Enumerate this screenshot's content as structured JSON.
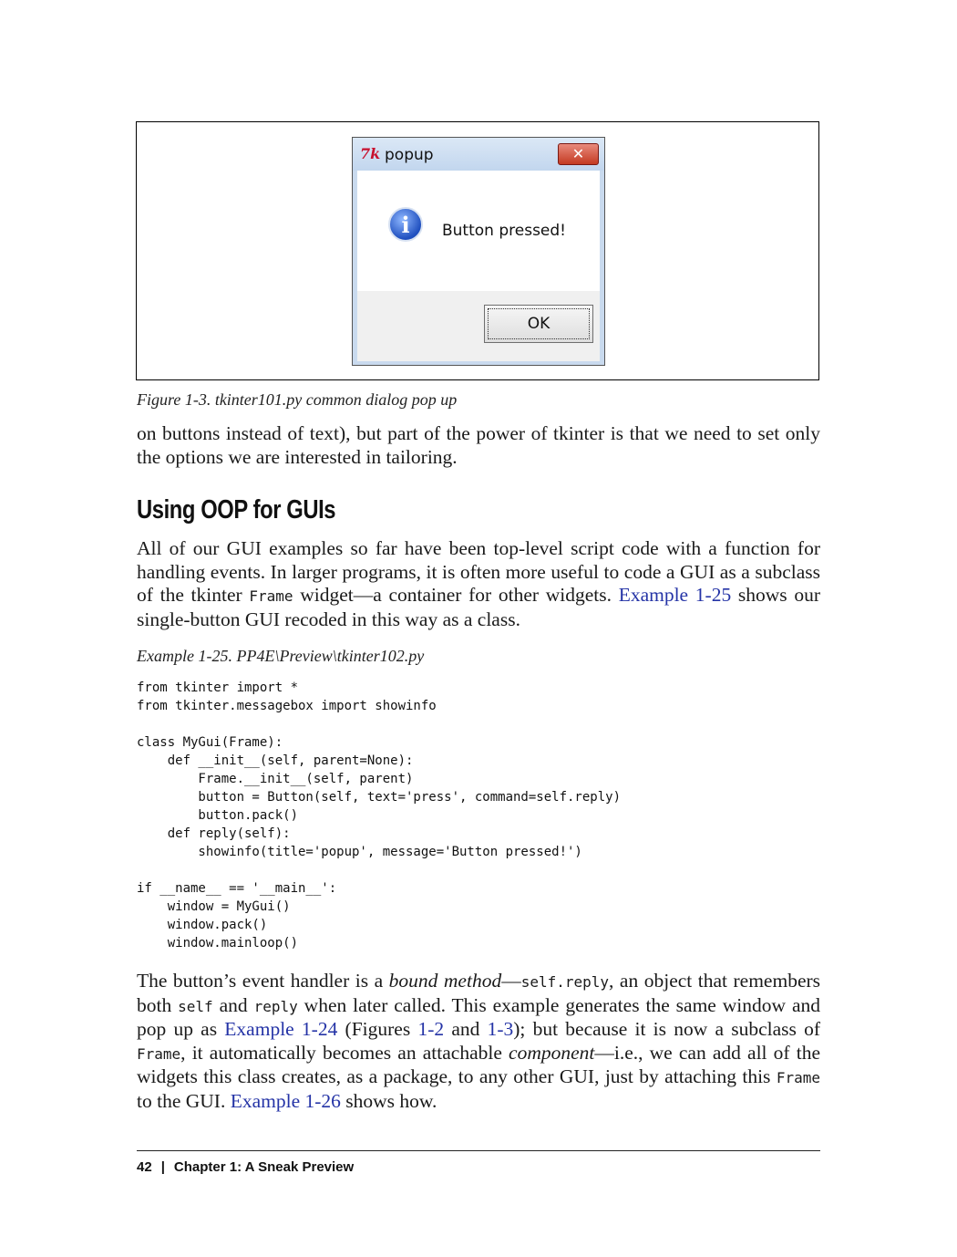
{
  "figure": {
    "dialog": {
      "title": "popup",
      "message": "Button pressed!",
      "ok_label": "OK",
      "close_glyph": "✕",
      "tk_icon_text": "7k",
      "info_icon_glyph": "i"
    },
    "caption": "Figure 1-3. tkinter101.py common dialog pop up"
  },
  "intro_para": {
    "line1": "on buttons instead of text), but part of the power of tkinter is that we need to set only",
    "line2": "the options we are interested in tailoring."
  },
  "section": {
    "heading": "Using OOP for GUIs",
    "p1": {
      "line1": "All of our GUI examples so far have been top-level script code with a function for",
      "line2": "handling events. In larger programs, it is often more useful to code a GUI as a subclass",
      "line3_pre": "of the tkinter ",
      "line3_code": "Frame",
      "line3_mid": " widget—a container for other widgets. ",
      "line3_link": "Example 1-25",
      "line3_post": " shows our",
      "line4": "single-button GUI recoded in this way as a class."
    },
    "example_title": "Example 1-25. PP4E\\Preview\\tkinter102.py",
    "code": "from tkinter import *\nfrom tkinter.messagebox import showinfo\n\nclass MyGui(Frame):\n    def __init__(self, parent=None):\n        Frame.__init__(self, parent)\n        button = Button(self, text='press', command=self.reply)\n        button.pack()\n    def reply(self):\n        showinfo(title='popup', message='Button pressed!')\n\nif __name__ == '__main__':\n    window = MyGui()\n    window.pack()\n    window.mainloop()",
    "p2": {
      "l1_a": "The button’s event handler is a ",
      "l1_em": "bound method",
      "l1_b": "—",
      "l1_code": "self.reply",
      "l1_c": ", an object that remembers",
      "l2_a": "both ",
      "l2_code1": "self",
      "l2_b": " and ",
      "l2_code2": "reply",
      "l2_c": " when later called. This example generates the same window and",
      "l3_a": "pop up as ",
      "l3_link1": "Example 1-24",
      "l3_b": " (Figures ",
      "l3_link2": "1-2",
      "l3_c": " and ",
      "l3_link3": "1-3",
      "l3_d": "); but because it is now a subclass of",
      "l4_code": "Frame",
      "l4_a": ", it automatically becomes an attachable ",
      "l4_em": "component",
      "l4_b": "—i.e., we can add all of the",
      "l5_a": "widgets this class creates, as a package, to any other GUI, just by attaching this ",
      "l5_code": "Frame",
      "l6_a": "to the GUI. ",
      "l6_link": "Example 1-26",
      "l6_b": " shows how."
    }
  },
  "footer": {
    "page_number": "42",
    "separator": "|",
    "chapter": "Chapter 1:  A Sneak Preview"
  }
}
